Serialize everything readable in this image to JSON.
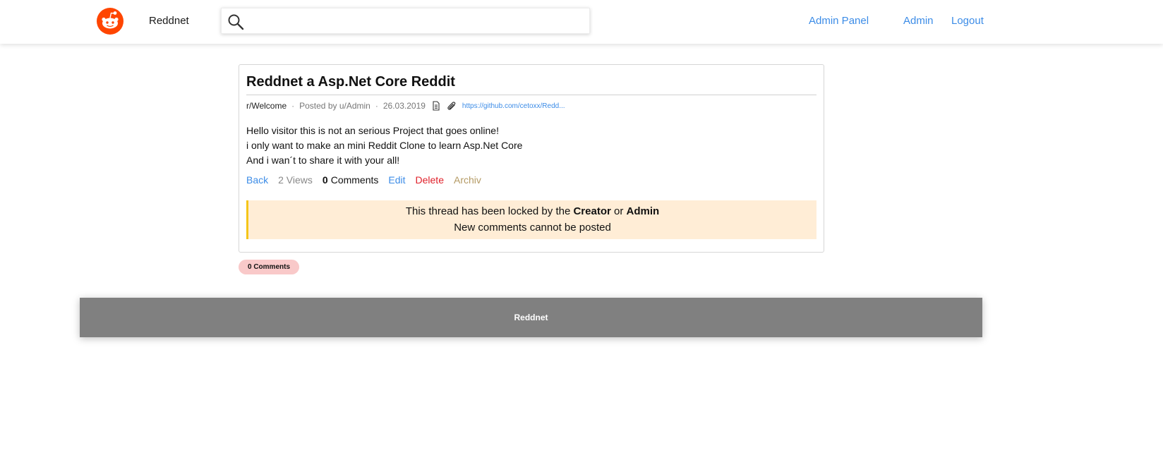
{
  "navbar": {
    "logo_icon": "reddit-alien-icon",
    "brand": "Reddnet",
    "search": {
      "icon": "search-icon",
      "value": "",
      "placeholder": ""
    },
    "links": {
      "admin_panel": "Admin Panel",
      "admin": "Admin",
      "logout": "Logout"
    }
  },
  "post": {
    "title": "Reddnet a Asp.Net Core Reddit",
    "meta": {
      "subreddit": "r/Welcome",
      "separator": "·",
      "posted_by": "Posted by u/Admin",
      "date": "26.03.2019",
      "icons": [
        "document-icon",
        "paperclip-icon"
      ],
      "link": "https://github.com/cetoxx/Redd..."
    },
    "body": [
      "Hello visitor this is not an serious Project that goes online!",
      "i only want to make an mini Reddit Clone to learn Asp.Net Core",
      "And i wan´t to share it with your all!"
    ],
    "actions": {
      "back": "Back",
      "views": "2 Views",
      "comments_count": "0",
      "comments_label": "Comments",
      "edit": "Edit",
      "delete": "Delete",
      "archiv": "Archiv"
    },
    "lock_notice": {
      "pre": "This thread has been locked by the",
      "creator": "Creator",
      "or": "or",
      "admin": "Admin",
      "line2": "New comments cannot be posted"
    }
  },
  "comments_badge": "0 Comments",
  "footer": {
    "text": "Reddnet"
  },
  "colors": {
    "brand": "#ff4500",
    "link": "#3c8ce7",
    "delete": "#e0202a",
    "archiv": "#b49a64",
    "notice_bg": "#ffedd6",
    "notice_border": "#f5c518",
    "badge_bg": "#f9c9c9",
    "footer_bg": "#808080"
  }
}
